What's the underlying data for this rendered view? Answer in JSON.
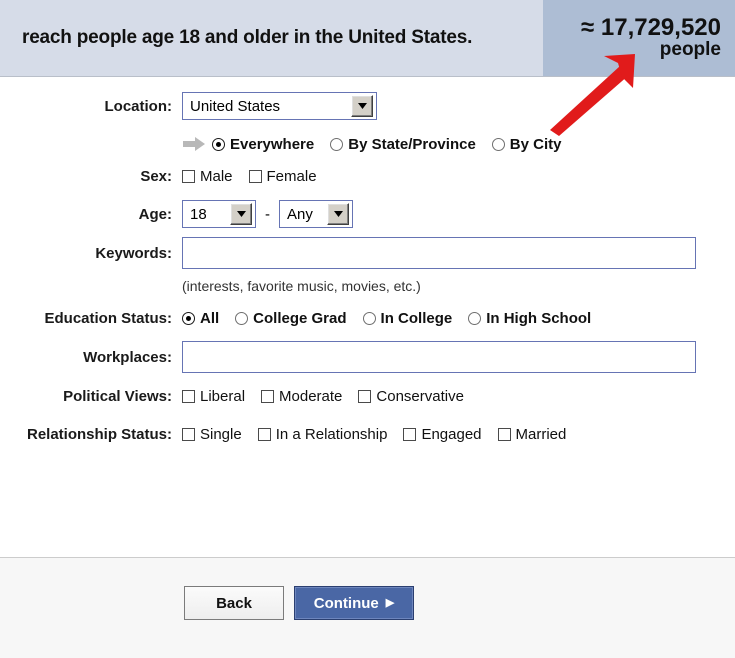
{
  "header": {
    "reach_text": "reach people age 18 and older in the United States.",
    "count_approx": "≈ 17,729,520",
    "count_unit": "people",
    "panel_color": "#adbdd4",
    "band_color": "#d6dce8"
  },
  "annotation": {
    "arrow_icon": "red-arrow-up-right",
    "color": "#e11b1b"
  },
  "form": {
    "location": {
      "label": "Location:",
      "selected": "United States",
      "scope_icon": "gray-arrow-right",
      "options": [
        {
          "label": "Everywhere",
          "selected": true
        },
        {
          "label": "By State/Province",
          "selected": false
        },
        {
          "label": "By City",
          "selected": false
        }
      ]
    },
    "sex": {
      "label": "Sex:",
      "options": [
        {
          "label": "Male",
          "checked": false
        },
        {
          "label": "Female",
          "checked": false
        }
      ]
    },
    "age": {
      "label": "Age:",
      "from": "18",
      "separator": "-",
      "to": "Any"
    },
    "keywords": {
      "label": "Keywords:",
      "value": "",
      "placeholder": "",
      "hint": "(interests, favorite music, movies, etc.)"
    },
    "education": {
      "label": "Education Status:",
      "options": [
        {
          "label": "All",
          "selected": true
        },
        {
          "label": "College Grad",
          "selected": false
        },
        {
          "label": "In College",
          "selected": false
        },
        {
          "label": "In High School",
          "selected": false
        }
      ]
    },
    "workplaces": {
      "label": "Workplaces:",
      "value": "",
      "placeholder": ""
    },
    "political": {
      "label": "Political Views:",
      "options": [
        {
          "label": "Liberal",
          "checked": false
        },
        {
          "label": "Moderate",
          "checked": false
        },
        {
          "label": "Conservative",
          "checked": false
        }
      ]
    },
    "relationship": {
      "label": "Relationship Status:",
      "options": [
        {
          "label": "Single",
          "checked": false
        },
        {
          "label": "In a Relationship",
          "checked": false
        },
        {
          "label": "Engaged",
          "checked": false
        },
        {
          "label": "Married",
          "checked": false
        }
      ]
    }
  },
  "footer": {
    "back_label": "Back",
    "continue_label": "Continue",
    "continue_caret": "▶",
    "continue_color": "#4a67a5"
  }
}
